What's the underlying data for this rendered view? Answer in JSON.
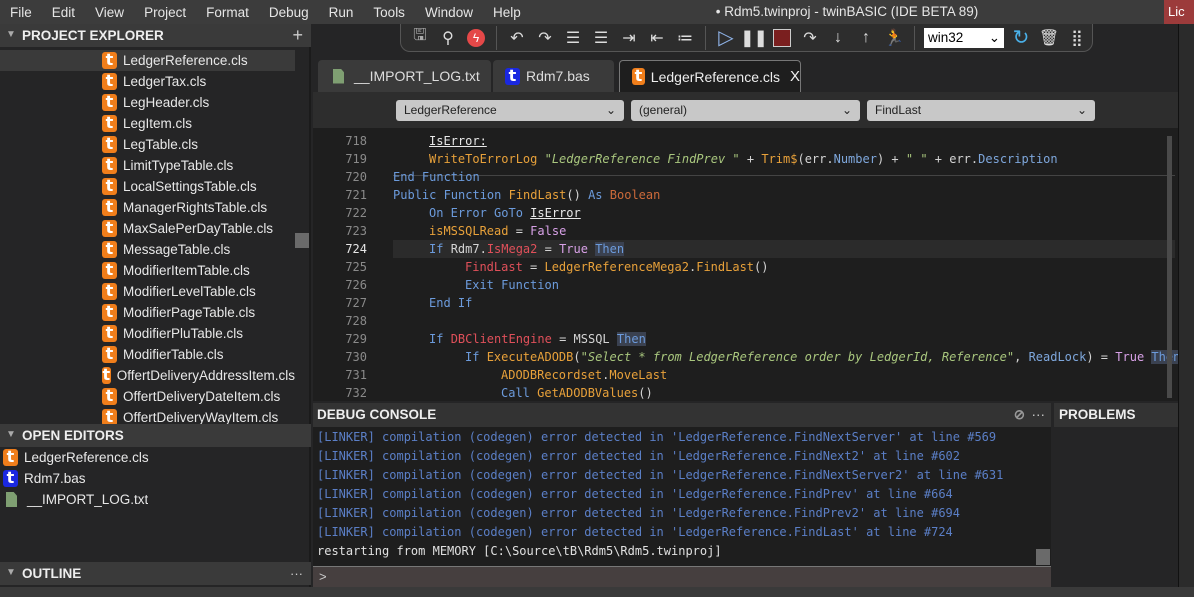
{
  "menu": [
    "File",
    "Edit",
    "View",
    "Project",
    "Format",
    "Debug",
    "Run",
    "Tools",
    "Window",
    "Help"
  ],
  "window_title": "• Rdm5.twinproj - twinBASIC (IDE BETA 89)",
  "license_button": "Lic",
  "project_explorer": {
    "title": "PROJECT EXPLORER",
    "add": "+",
    "items": [
      "LedgerReference.cls",
      "LedgerTax.cls",
      "LegHeader.cls",
      "LegItem.cls",
      "LegTable.cls",
      "LimitTypeTable.cls",
      "LocalSettingsTable.cls",
      "ManagerRightsTable.cls",
      "MaxSalePerDayTable.cls",
      "MessageTable.cls",
      "ModifierItemTable.cls",
      "ModifierLevelTable.cls",
      "ModifierPageTable.cls",
      "ModifierPluTable.cls",
      "ModifierTable.cls",
      "OffertDeliveryAddressItem.cls",
      "OffertDeliveryDateItem.cls",
      "OffertDeliveryWayItem.cls"
    ],
    "selected": 0
  },
  "open_editors": {
    "title": "OPEN EDITORS",
    "items": [
      {
        "label": "LedgerReference.cls",
        "icon": "orange"
      },
      {
        "label": "Rdm7.bas",
        "icon": "blue"
      },
      {
        "label": "__IMPORT_LOG.txt",
        "icon": "file"
      }
    ]
  },
  "outline": {
    "title": "OUTLINE",
    "more": "···"
  },
  "toolbar": {
    "platform": "win32"
  },
  "tabs": [
    {
      "label": "__IMPORT_LOG.txt",
      "icon": "file"
    },
    {
      "label": "Rdm7.bas",
      "icon": "blue"
    },
    {
      "label": "LedgerReference.cls",
      "icon": "orange",
      "active": true,
      "close": "X"
    }
  ],
  "selectors": {
    "module": "LedgerReference",
    "object": "(general)",
    "procedure": "FindLast"
  },
  "code": {
    "current_line": 724,
    "lines": [
      {
        "n": 718,
        "indent": 1,
        "t": [
          [
            "IsError:",
            "lb"
          ]
        ]
      },
      {
        "n": 719,
        "indent": 1,
        "t": [
          [
            "WriteToErrorLog ",
            "o"
          ],
          [
            "\"LedgerReference FindPrev \"",
            "s"
          ],
          [
            " + ",
            "p"
          ],
          [
            "Trim$",
            "o"
          ],
          [
            "(err.",
            "p"
          ],
          [
            "Number",
            "pr"
          ],
          [
            ") + ",
            "p"
          ],
          [
            "\" \"",
            "s"
          ],
          [
            " + err.",
            "p"
          ],
          [
            "Description",
            "pr"
          ]
        ]
      },
      {
        "n": 720,
        "indent": 0,
        "t": [
          [
            "End Function",
            "k"
          ]
        ]
      },
      {
        "n": 721,
        "indent": 0,
        "t": [
          [
            "Public Function ",
            "k"
          ],
          [
            "FindLast",
            "o"
          ],
          [
            "() ",
            "p"
          ],
          [
            "As ",
            "k"
          ],
          [
            "Boolean",
            "bl"
          ]
        ]
      },
      {
        "n": 722,
        "indent": 1,
        "t": [
          [
            "On Error GoTo ",
            "k"
          ],
          [
            "IsError",
            "lb"
          ]
        ]
      },
      {
        "n": 723,
        "indent": 1,
        "t": [
          [
            "isMSSQLRead",
            "o"
          ],
          [
            " = ",
            "p"
          ],
          [
            "False",
            "v"
          ]
        ]
      },
      {
        "n": 724,
        "indent": 1,
        "t": [
          [
            "If ",
            "k"
          ],
          [
            "Rdm7.",
            "p"
          ],
          [
            "IsMega2",
            "r"
          ],
          [
            " = ",
            "p"
          ],
          [
            "True ",
            "v"
          ],
          [
            "Then",
            "k hl"
          ]
        ]
      },
      {
        "n": 725,
        "indent": 2,
        "t": [
          [
            "FindLast",
            "r"
          ],
          [
            " = ",
            "p"
          ],
          [
            "LedgerReferenceMega2",
            "o"
          ],
          [
            ".",
            "p"
          ],
          [
            "FindLast",
            "o"
          ],
          [
            "()",
            "p"
          ]
        ]
      },
      {
        "n": 726,
        "indent": 2,
        "t": [
          [
            "Exit Function",
            "k"
          ]
        ]
      },
      {
        "n": 727,
        "indent": 1,
        "t": [
          [
            "End If",
            "k"
          ]
        ]
      },
      {
        "n": 728,
        "indent": 0,
        "t": []
      },
      {
        "n": 729,
        "indent": 1,
        "t": [
          [
            "If ",
            "k"
          ],
          [
            "DBClientEngine",
            "r"
          ],
          [
            " = ",
            "p"
          ],
          [
            "MSSQL ",
            "p"
          ],
          [
            "Then",
            "k hl"
          ]
        ]
      },
      {
        "n": 730,
        "indent": 2,
        "t": [
          [
            "If ",
            "k"
          ],
          [
            "ExecuteADODB",
            "o"
          ],
          [
            "(",
            "p"
          ],
          [
            "\"Select * from LedgerReference order by LedgerId, Reference\"",
            "s"
          ],
          [
            ", ",
            "p"
          ],
          [
            "ReadLock",
            "pr"
          ],
          [
            ") = ",
            "p"
          ],
          [
            "True ",
            "v"
          ],
          [
            "Then",
            "k hl"
          ]
        ]
      },
      {
        "n": 731,
        "indent": 3,
        "t": [
          [
            "ADODBRecordset",
            "o"
          ],
          [
            ".",
            "p"
          ],
          [
            "MoveLast",
            "o"
          ]
        ]
      },
      {
        "n": 732,
        "indent": 3,
        "t": [
          [
            "Call ",
            "k"
          ],
          [
            "GetADODBValues",
            "o"
          ],
          [
            "()",
            "p"
          ]
        ]
      }
    ]
  },
  "debug_console": {
    "title": "DEBUG CONSOLE",
    "more": "···",
    "lines": [
      "[LINKER] compilation (codegen) error detected in 'LedgerReference.FindNextServer' at line #569",
      "[LINKER] compilation (codegen) error detected in 'LedgerReference.FindNext2' at line #602",
      "[LINKER] compilation (codegen) error detected in 'LedgerReference.FindNextServer2' at line #631",
      "[LINKER] compilation (codegen) error detected in 'LedgerReference.FindPrev' at line #664",
      "[LINKER] compilation (codegen) error detected in 'LedgerReference.FindPrev2' at line #694",
      "[LINKER] compilation (codegen) error detected in 'LedgerReference.FindLast' at line #724"
    ],
    "last_line": "restarting from MEMORY [C:\\Source\\tB\\Rdm5\\Rdm5.twinproj]",
    "prompt": ">"
  },
  "problems": {
    "title": "PROBLEMS"
  }
}
